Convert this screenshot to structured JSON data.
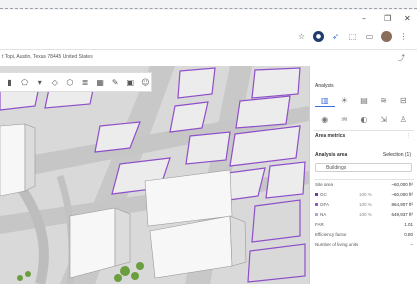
{
  "browser": {
    "window_controls": {
      "minimize": "–",
      "restore": "❐",
      "close": "✕"
    },
    "address": "t Topi, Austin, Texas 78445 United States",
    "toolbar_icons": [
      "star-icon",
      "extension-icon",
      "wing-icon",
      "puzzle-icon",
      "sidepanel-icon",
      "profile-icon",
      "menu-icon"
    ]
  },
  "map_toolbar": {
    "tools": [
      "ruler-icon",
      "polygon-icon",
      "dropdown-icon",
      "shape-icon",
      "cube-icon",
      "layers-icon",
      "grid-icon",
      "drawing-icon",
      "save-icon",
      "people-icon"
    ]
  },
  "panel": {
    "title": "Analysis",
    "area_metrics": "Area metrics",
    "analysis_area_label": "Analysis area",
    "selection_value": "Selection (1)",
    "buildings_chip": "Buildings",
    "site_area": {
      "label": "Site area",
      "value": "~60,000 ft²"
    },
    "metrics": [
      {
        "label": "GC",
        "pct": "100 %",
        "value": "~60,000 ft²",
        "color": "#6b3fa0"
      },
      {
        "label": "GFA",
        "pct": "100 %",
        "value": "864,907 ft²",
        "color": "#8b5cc7"
      },
      {
        "label": "NA",
        "pct": "100 %",
        "value": "649,937 ft²",
        "color": "#b8a0e0"
      },
      {
        "label": "FAR",
        "pct": "",
        "value": "1.01",
        "color": ""
      },
      {
        "label": "Efficiency factor",
        "pct": "",
        "value": "0.80",
        "color": ""
      },
      {
        "label": "Number of living units",
        "pct": "",
        "value": "–",
        "color": ""
      }
    ]
  },
  "colors": {
    "accent": "#3b6fd8",
    "building_outline": "#8e4fc9",
    "road": "#c9c9c9",
    "building": "#efefef"
  }
}
